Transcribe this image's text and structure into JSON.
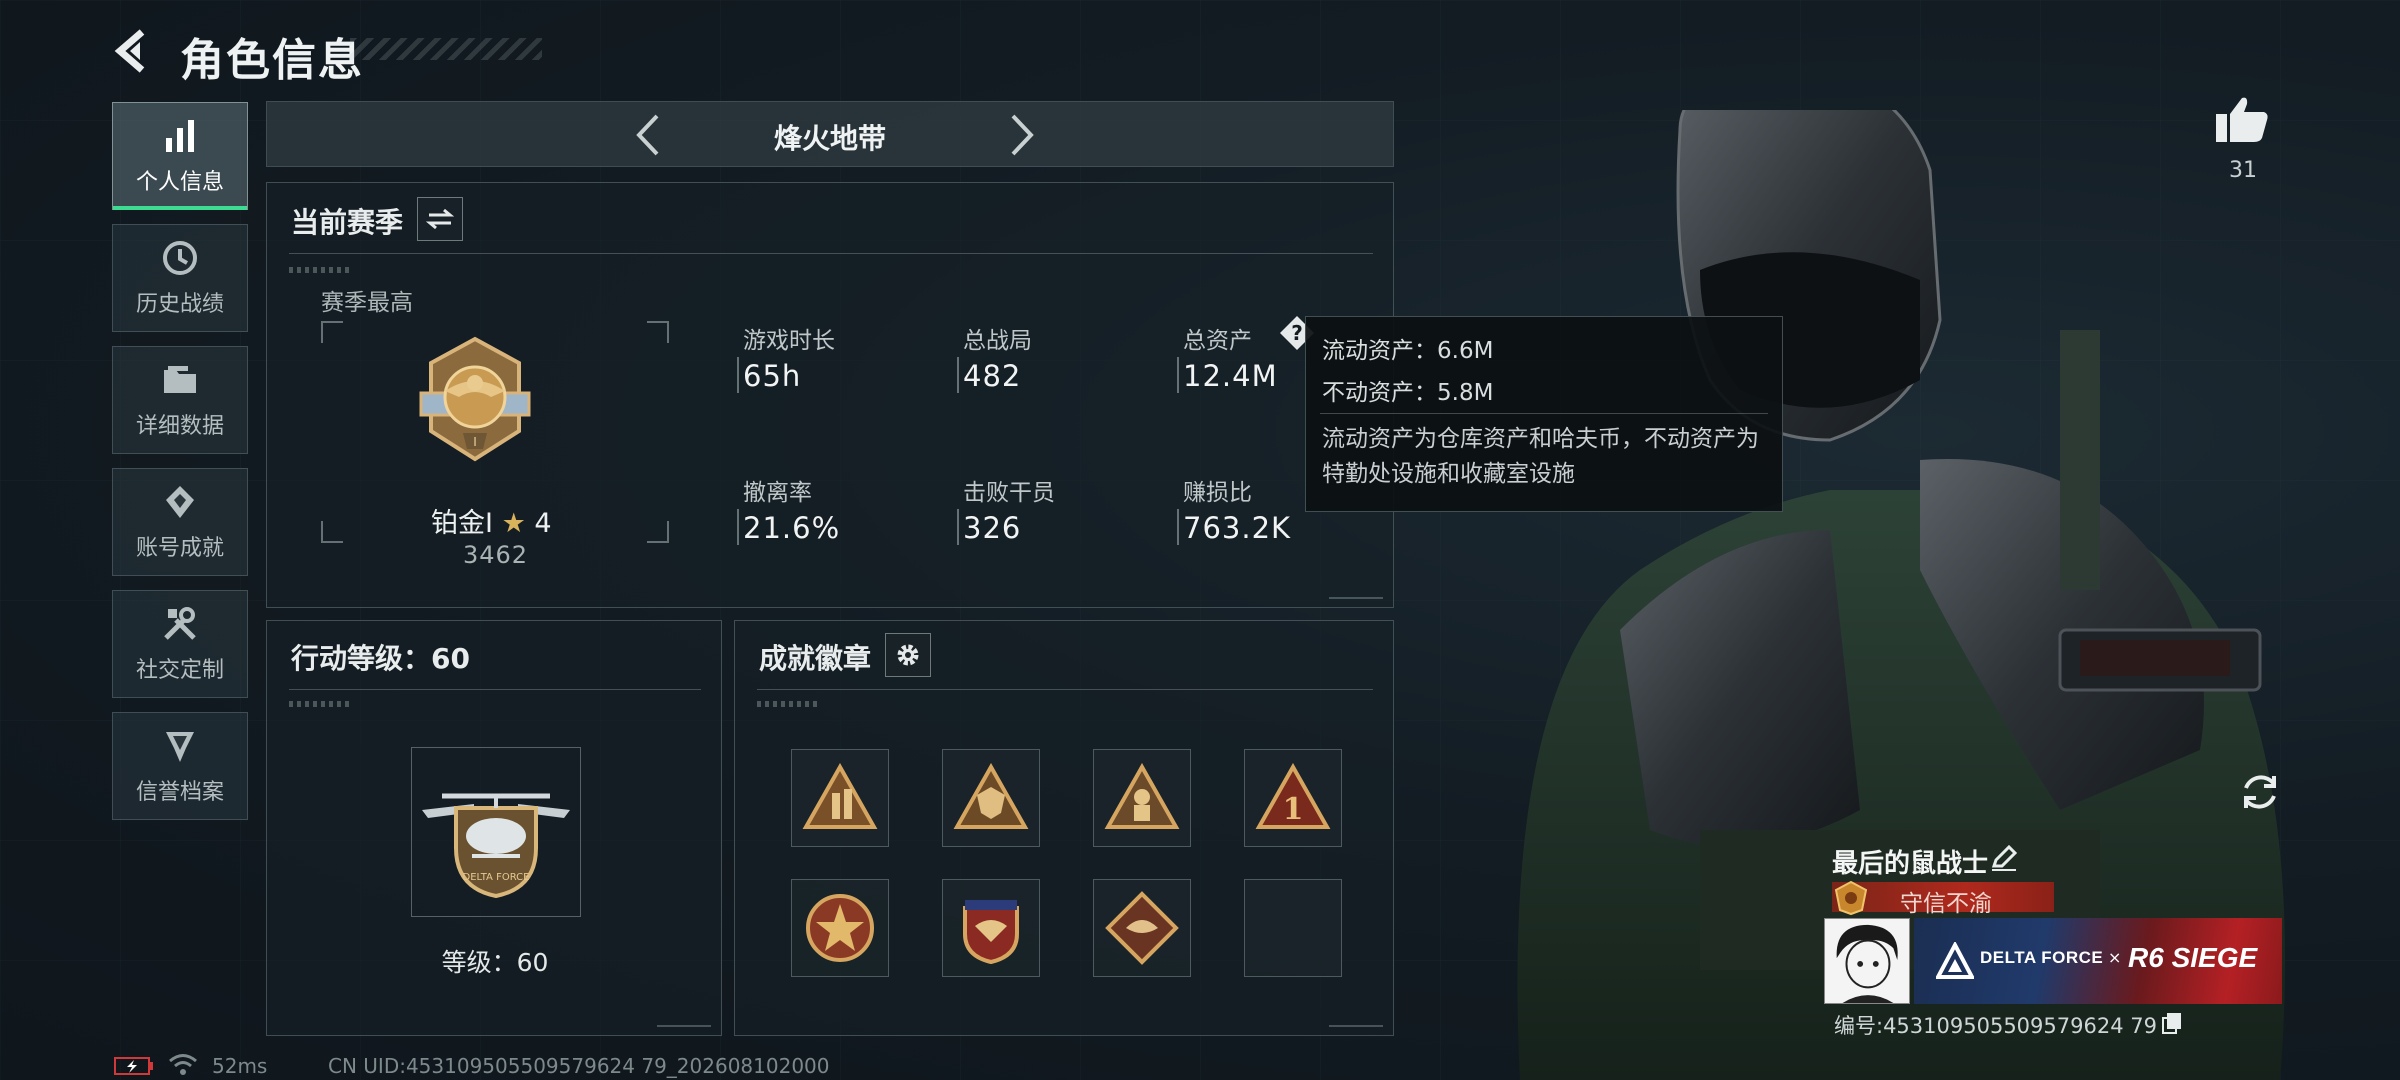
{
  "header": {
    "title": "角色信息"
  },
  "sidebar": {
    "items": [
      {
        "label": "个人信息",
        "icon": "bar-chart-icon",
        "active": true
      },
      {
        "label": "历史战绩",
        "icon": "history-clock-icon",
        "active": false
      },
      {
        "label": "详细数据",
        "icon": "folder-icon",
        "active": false
      },
      {
        "label": "账号成就",
        "icon": "achievement-icon",
        "active": false
      },
      {
        "label": "社交定制",
        "icon": "tools-icon",
        "active": false
      },
      {
        "label": "信誉档案",
        "icon": "reputation-icon",
        "active": false
      }
    ]
  },
  "mode_selector": {
    "title": "烽火地带"
  },
  "season": {
    "title": "当前赛季",
    "best_label": "赛季最高",
    "rank_name": "铂金I",
    "rank_stars": "4",
    "rank_score": "3462",
    "stats": [
      {
        "label": "游戏时长",
        "value": "65h"
      },
      {
        "label": "总战局",
        "value": "482"
      },
      {
        "label": "总资产",
        "value": "12.4M"
      },
      {
        "label": "撤离率",
        "value": "21.6%"
      },
      {
        "label": "击败干员",
        "value": "326"
      },
      {
        "label": "赚损比",
        "value": "763.2K"
      }
    ]
  },
  "tooltip": {
    "liquid": "流动资产：6.6M",
    "fixed": "不动资产：5.8M",
    "description": "流动资产为仓库资产和哈夫币，不动资产为特勤处设施和收藏室设施"
  },
  "action_level": {
    "title": "行动等级：60",
    "level_label": "等级：60"
  },
  "achievements": {
    "title": "成就徽章",
    "badges": [
      "soldiers-badge",
      "shield-triangle-badge",
      "operator-badge",
      "number-one-badge",
      "star-emblem-badge",
      "winged-crest-badge",
      "eagle-diamond-badge",
      "empty-slot"
    ]
  },
  "profile": {
    "likes": "31",
    "name": "最后的鼠战士",
    "honor": "守信不渝",
    "banner_left": "DELTA FORCE",
    "banner_x": "×",
    "banner_right": "R6 SIEGE",
    "player_id": "编号:453109505509579624 79"
  },
  "status": {
    "ping": "52ms",
    "uid": "CN UID:453109505509579624 79_202608102000"
  },
  "colors": {
    "accent": "#3ddc92",
    "honor_red": "#b0291d",
    "gold": "#c89a52"
  }
}
